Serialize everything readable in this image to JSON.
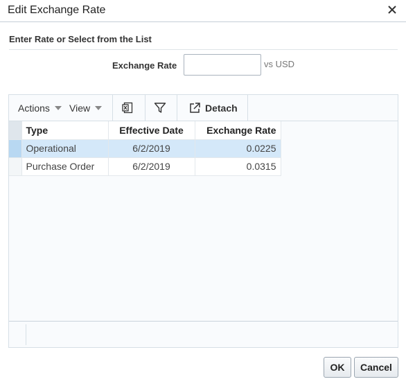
{
  "dialog": {
    "title": "Edit Exchange Rate",
    "section_title": "Enter Rate or Select from the List"
  },
  "rate_field": {
    "label": "Exchange Rate",
    "value": "",
    "suffix": "vs USD"
  },
  "toolbar": {
    "actions_label": "Actions",
    "view_label": "View",
    "export_icon": "export-excel-icon",
    "filter_icon": "filter-icon",
    "detach_label": "Detach"
  },
  "table": {
    "columns": [
      "Type",
      "Effective Date",
      "Exchange Rate"
    ],
    "rows": [
      {
        "type": "Operational",
        "effective_date": "6/2/2019",
        "exchange_rate": "0.0225",
        "selected": true
      },
      {
        "type": "Purchase Order",
        "effective_date": "6/2/2019",
        "exchange_rate": "0.0315",
        "selected": false
      }
    ]
  },
  "buttons": {
    "ok_label": "OK",
    "cancel_label": "Cancel"
  },
  "colors": {
    "selected_row": "#d4e8f9",
    "border": "#d6dfe6"
  }
}
